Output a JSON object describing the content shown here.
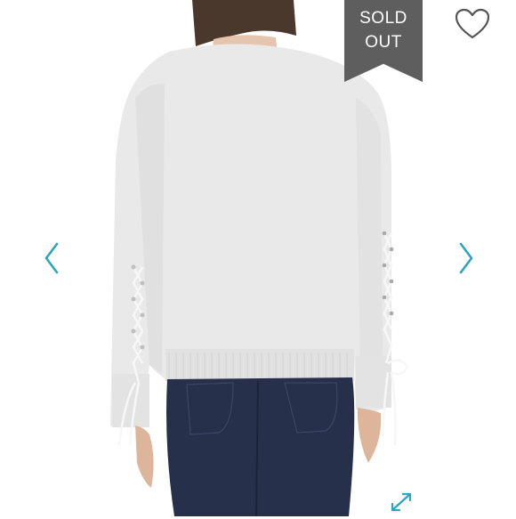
{
  "listing": {
    "sold_label_line1": "SOLD",
    "sold_label_line2": "OUT"
  },
  "icons": {
    "like": "heart-icon",
    "previous": "chevron-left-icon",
    "next": "chevron-right-icon",
    "expand": "expand-icon"
  },
  "colors": {
    "banner": "#5e5e5e",
    "accent": "#2aa6bf",
    "icon": "#555555"
  }
}
